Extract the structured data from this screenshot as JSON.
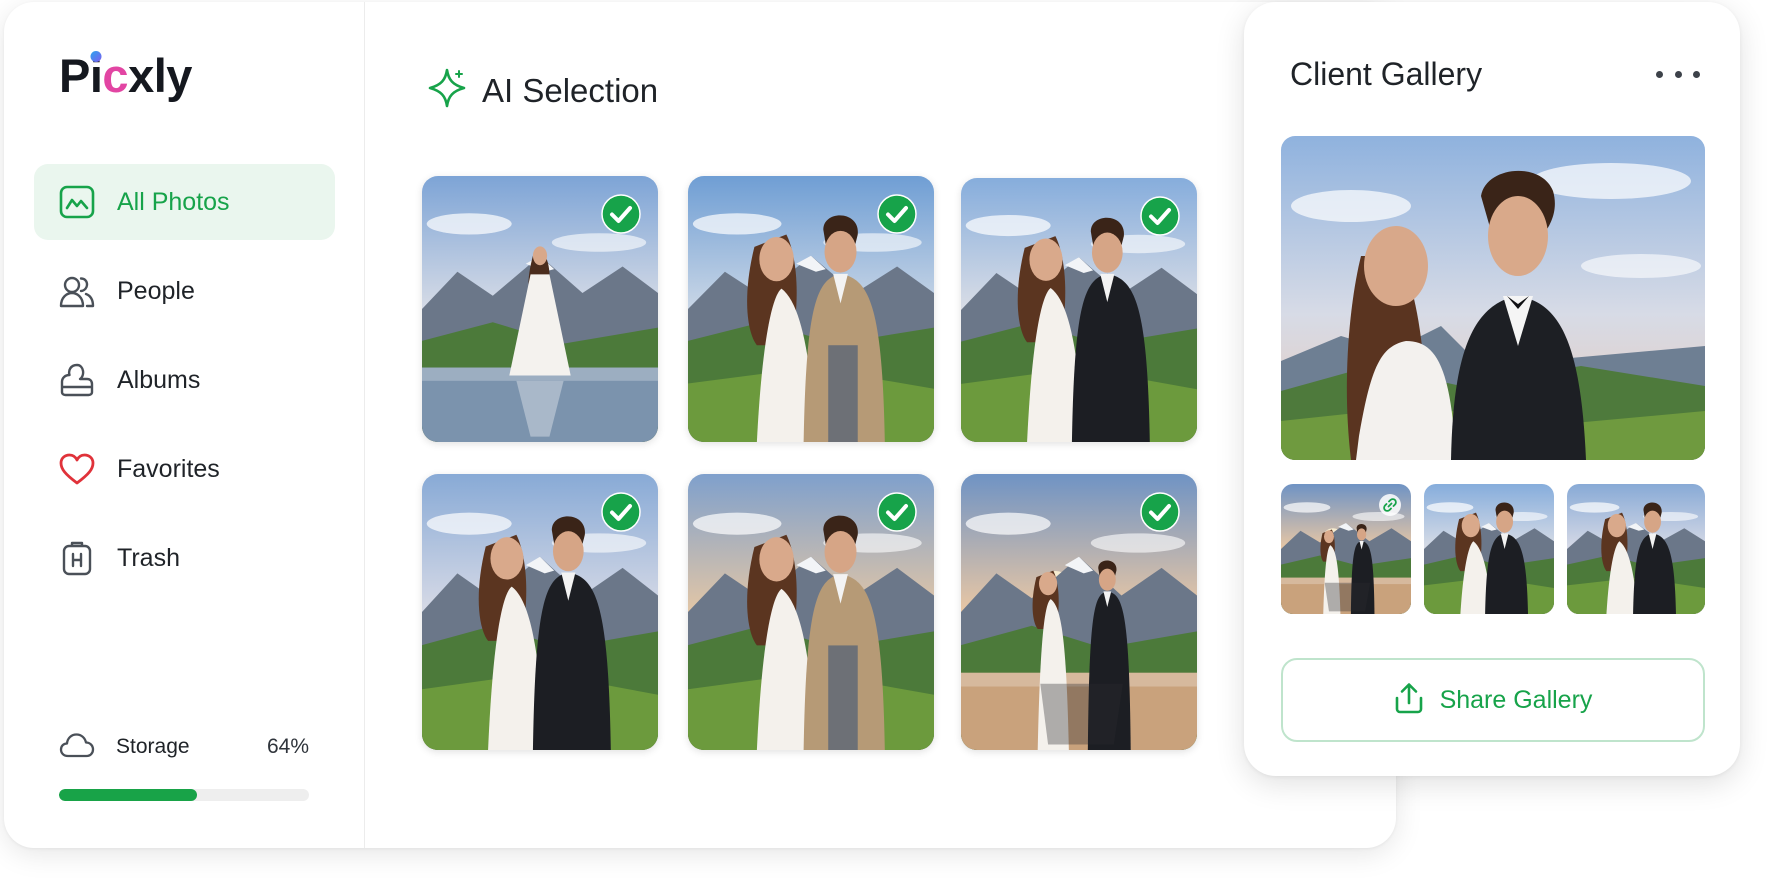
{
  "brand": {
    "logo_text": "Picxly",
    "logo_chars": [
      "P",
      "i",
      "c",
      "xly"
    ]
  },
  "sidebar": {
    "items": [
      {
        "label": "All Photos",
        "icon": "landscape-photo-icon",
        "active": true
      },
      {
        "label": "People",
        "icon": "people-icon",
        "active": false
      },
      {
        "label": "Albums",
        "icon": "albums-icon",
        "active": false
      },
      {
        "label": "Favorites",
        "icon": "heart-icon",
        "active": false
      },
      {
        "label": "Trash",
        "icon": "trash-icon",
        "active": false
      }
    ],
    "storage": {
      "label": "Storage",
      "percent_label": "64%",
      "percent": 0.55,
      "icon": "cloud-icon"
    }
  },
  "main": {
    "title": "AI Selection",
    "title_icon": "sparkle-icon",
    "photos": [
      {
        "subject": "bride-alone-by-lake",
        "selected": true
      },
      {
        "subject": "couple-sitting-on-grass",
        "selected": true
      },
      {
        "subject": "couple-embracing-tuxedo",
        "selected": true
      },
      {
        "subject": "couple-hugging-smiling",
        "selected": true
      },
      {
        "subject": "couple-sitting-cheek-to-cheek",
        "selected": true
      },
      {
        "subject": "couple-at-lake-sunset",
        "selected": true
      }
    ]
  },
  "client_gallery": {
    "title": "Client Gallery",
    "more_icon": "more-horizontal-icon",
    "thumbnails": [
      {
        "subject": "couple-at-lake",
        "badge_icon": "link-icon"
      },
      {
        "subject": "couple-on-meadow"
      },
      {
        "subject": "couple-on-hill"
      }
    ],
    "share_label": "Share Gallery",
    "share_icon": "share-upload-icon"
  },
  "colors": {
    "accent": "#17a34a",
    "active_bg": "#eaf6ee",
    "heart": "#e0323a",
    "share_border": "#bfe4cc"
  }
}
